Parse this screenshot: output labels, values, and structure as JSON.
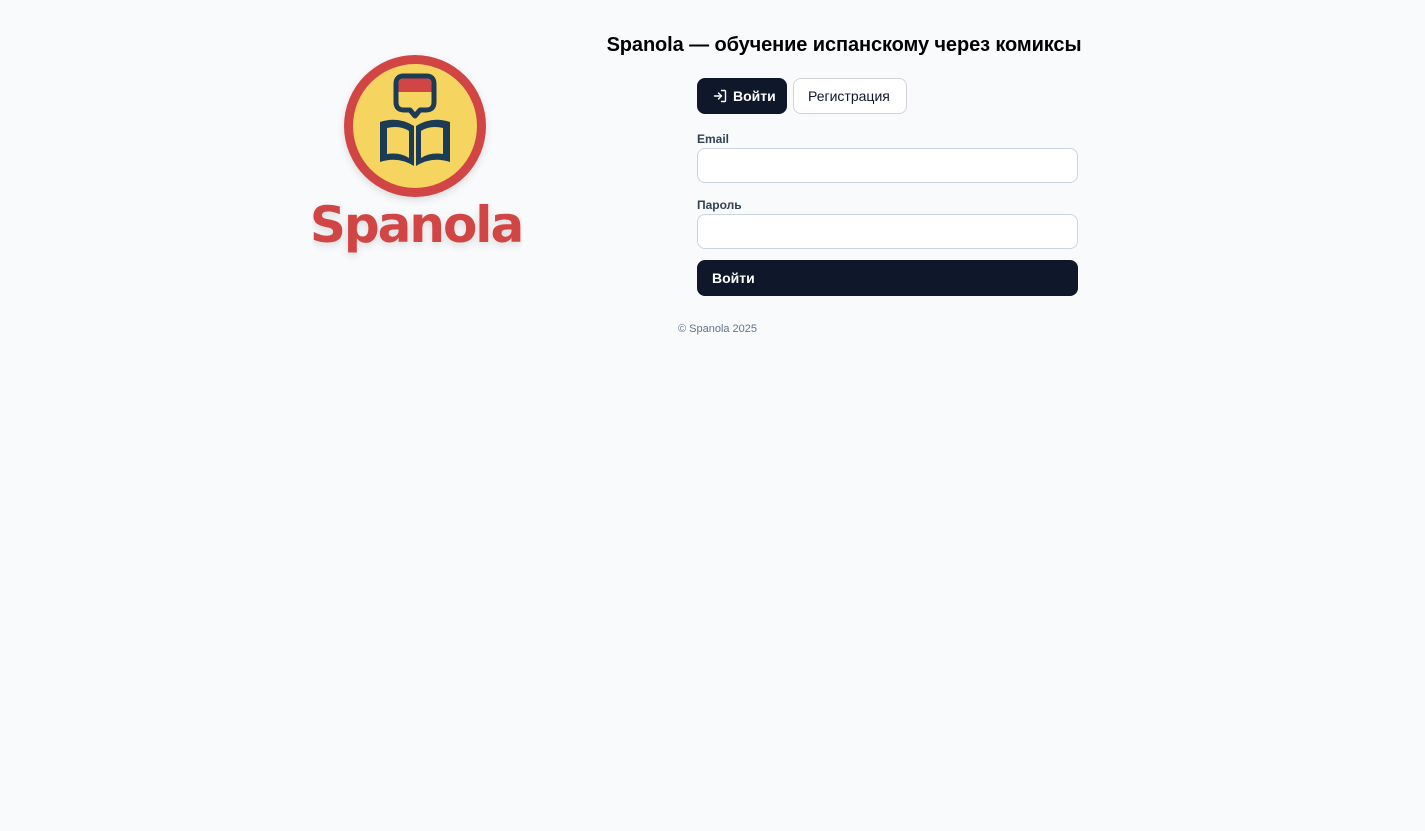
{
  "brand": {
    "logo_text": "Spanola",
    "colors": {
      "red": "#d24545",
      "yellow": "#f5d45f",
      "navy": "#1e3a55"
    }
  },
  "header": {
    "title": "Spanola — обучение испанскому через комиксы"
  },
  "tabs": {
    "login_label": "Войти",
    "login_icon": "login-arrow-icon",
    "register_label": "Регистрация"
  },
  "form": {
    "email_label": "Email",
    "email_value": "",
    "password_label": "Пароль",
    "password_value": "",
    "submit_label": "Войти"
  },
  "footer": {
    "text": "© Spanola 2025"
  },
  "colors": {
    "background": "#f8fafc",
    "primary": "#0f172a",
    "border": "#cbd5e1"
  }
}
